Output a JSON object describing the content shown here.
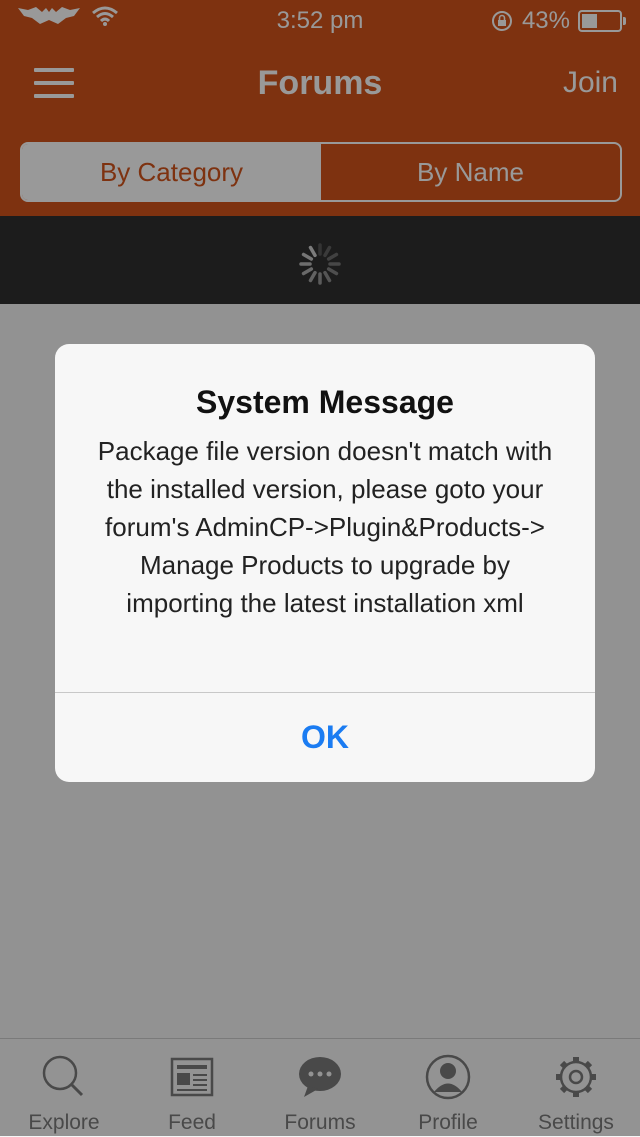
{
  "status_bar": {
    "time": "3:52 pm",
    "battery_percent": "43%",
    "battery_level": 0.43
  },
  "navbar": {
    "title": "Forums",
    "join_label": "Join"
  },
  "segments": {
    "by_category": "By Category",
    "by_name": "By Name",
    "selected": "by_category"
  },
  "tabs": [
    {
      "label": "Explore",
      "icon": "search-icon"
    },
    {
      "label": "Feed",
      "icon": "newspaper-icon"
    },
    {
      "label": "Forums",
      "icon": "chat-bubble-icon"
    },
    {
      "label": "Profile",
      "icon": "person-icon"
    },
    {
      "label": "Settings",
      "icon": "gear-icon"
    }
  ],
  "alert": {
    "title": "System Message",
    "message": "Package file version doesn't match with the installed version, please goto your forum's AdminCP->Plugin&Products-> Manage Products to upgrade by importing the latest installation xml",
    "ok_label": "OK"
  },
  "colors": {
    "brand": "#d2541b",
    "ok_button": "#1b7cf2",
    "loading_bar": "#2f2f2f"
  }
}
